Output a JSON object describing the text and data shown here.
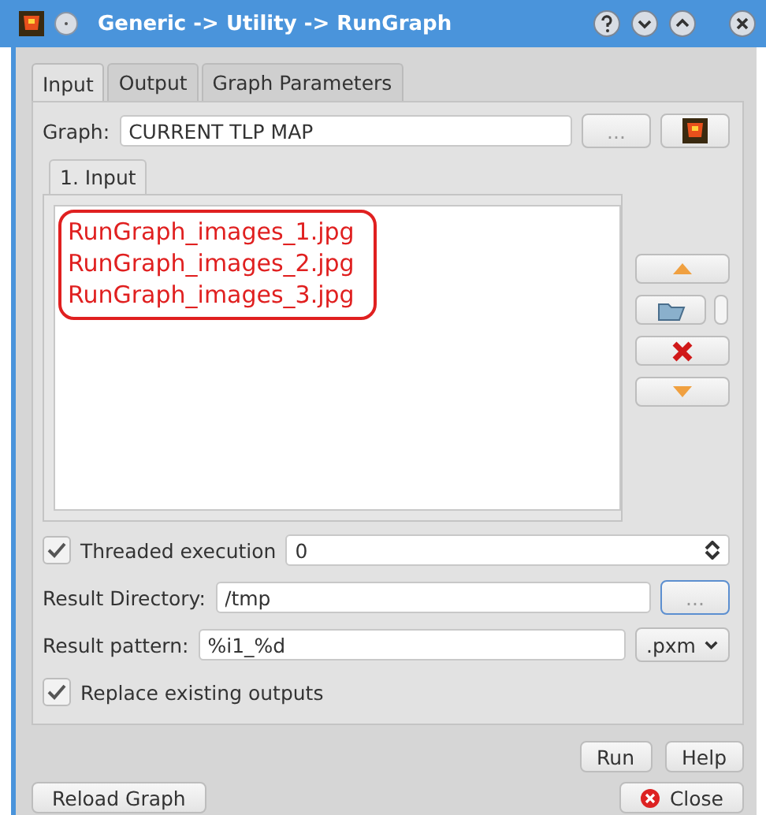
{
  "window": {
    "title": "Generic -> Utility -> RunGraph"
  },
  "tabs": [
    {
      "label": "Input",
      "selected": true
    },
    {
      "label": "Output",
      "selected": false
    },
    {
      "label": "Graph Parameters",
      "selected": false
    }
  ],
  "graph": {
    "label": "Graph:",
    "value": "CURRENT TLP MAP",
    "browse": "..."
  },
  "inner_tabs": [
    {
      "label": "1. Input",
      "selected": true
    }
  ],
  "input_list": {
    "highlighted": true,
    "items": [
      "RunGraph_images_1.jpg",
      "RunGraph_images_2.jpg",
      "RunGraph_images_3.jpg"
    ]
  },
  "threaded": {
    "label": "Threaded execution",
    "checked": true,
    "value": "0"
  },
  "result_directory": {
    "label": "Result Directory:",
    "value": "/tmp",
    "browse": "..."
  },
  "result_pattern": {
    "label": "Result pattern:",
    "value": "%i1_%d",
    "format": ".pxm"
  },
  "replace": {
    "label": "Replace existing outputs",
    "checked": true
  },
  "buttons": {
    "run": "Run",
    "help": "Help",
    "reload": "Reload Graph",
    "close": "Close"
  }
}
